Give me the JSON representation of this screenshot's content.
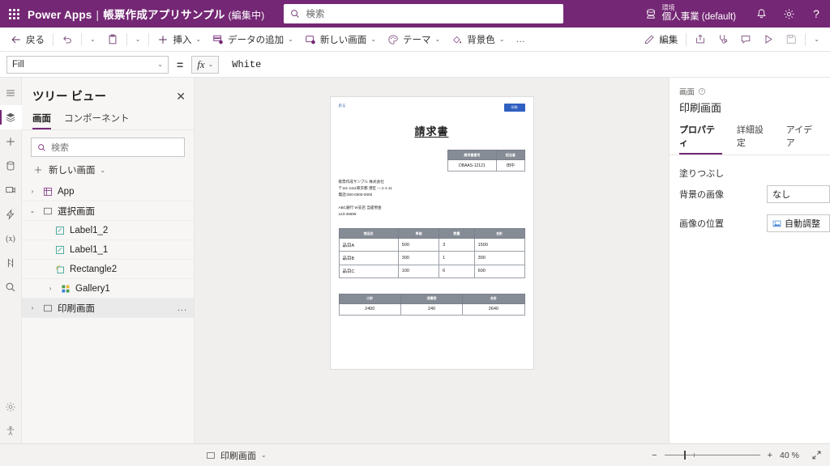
{
  "header": {
    "waffle_icon": "app-launcher-icon",
    "brand": "Power Apps",
    "separator": "|",
    "app_name": "帳票作成アプリサンプル",
    "editing_state": "(編集中)",
    "search_placeholder": "検索",
    "search_icon": "search-icon",
    "environment_label": "環境",
    "environment_value": "個人事業 (default)",
    "environment_icon": "environment-icon",
    "notification_icon": "bell-icon",
    "settings_icon": "gear-icon",
    "help_icon": "question-icon",
    "accent": "#742774"
  },
  "commandbar": {
    "back": "戻る",
    "back_icon": "arrow-left-icon",
    "undo_icon": "undo-icon",
    "paste_icon": "paste-icon",
    "insert": "挿入",
    "insert_icon": "plus-icon",
    "add_data": "データの追加",
    "add_data_icon": "database-add-icon",
    "new_screen": "新しい画面",
    "new_screen_icon": "new-screen-icon",
    "theme": "テーマ",
    "theme_icon": "palette-icon",
    "background_color": "背景色",
    "background_color_icon": "fill-color-icon",
    "overflow": "…",
    "edit": "編集",
    "edit_icon": "pencil-icon",
    "share_icon": "share-icon",
    "checker_icon": "app-checker-icon",
    "comment_icon": "comment-icon",
    "preview_icon": "play-icon",
    "save_icon": "save-icon",
    "more_chevron_icon": "chevron-down-icon"
  },
  "formulabar": {
    "property": "Fill",
    "equals": "=",
    "fx": "fx",
    "formula": "White"
  },
  "rail": {
    "items": [
      {
        "name": "hamburger-icon"
      },
      {
        "name": "tree-view-icon"
      },
      {
        "name": "insert-icon"
      },
      {
        "name": "data-icon"
      },
      {
        "name": "media-icon"
      },
      {
        "name": "power-automate-icon"
      },
      {
        "name": "variables-icon"
      },
      {
        "name": "advanced-tools-icon"
      },
      {
        "name": "search-icon"
      }
    ],
    "bottom": [
      {
        "name": "settings-icon"
      },
      {
        "name": "accessibility-icon"
      }
    ]
  },
  "treeview": {
    "title": "ツリー ビュー",
    "close_icon": "close-icon",
    "tabs": [
      {
        "label": "画面",
        "active": true
      },
      {
        "label": "コンポーネント",
        "active": false
      }
    ],
    "search_placeholder": "検索",
    "new_screen": "新しい画面",
    "nodes": [
      {
        "label": "App",
        "level": 0,
        "twist": "›",
        "icon": "app-icon",
        "selected": false
      },
      {
        "label": "選択画面",
        "level": 0,
        "twist": "⌄",
        "icon": "screen-icon",
        "selected": false
      },
      {
        "label": "Label1_2",
        "level": 2,
        "twist": "",
        "icon": "label-icon",
        "selected": false
      },
      {
        "label": "Label1_1",
        "level": 2,
        "twist": "",
        "icon": "label-icon",
        "selected": false
      },
      {
        "label": "Rectangle2",
        "level": 2,
        "twist": "",
        "icon": "rectangle-icon",
        "selected": false
      },
      {
        "label": "Gallery1",
        "level": 1,
        "twist": "›",
        "icon": "gallery-icon",
        "selected": false
      },
      {
        "label": "印刷画面",
        "level": 0,
        "twist": "›",
        "icon": "screen-icon",
        "selected": true,
        "overflow": "..."
      }
    ]
  },
  "canvas": {
    "back_label": "戻る",
    "print_button": "印刷",
    "invoice_title": "請求書",
    "meta_table": {
      "headers": [
        "請求書番号",
        "担当者"
      ],
      "values": [
        "DBAAS-12121",
        "田中"
      ]
    },
    "company_lines": [
      "帳票作成サンプル 株式会社",
      "〒111-1111東京都 港区 ○○1-1-11",
      "電話:000-0000-0000"
    ],
    "bank_lines": [
      "ABC銀行 W支店 当座預金",
      "123-45689"
    ],
    "items_table": {
      "headers": [
        "商品名",
        "単価",
        "数量",
        "合計"
      ],
      "rows": [
        [
          "品目A",
          "500",
          "3",
          "1500"
        ],
        [
          "品目B",
          "300",
          "1",
          "300"
        ],
        [
          "品目C",
          "100",
          "6",
          "600"
        ]
      ]
    },
    "totals_table": {
      "headers": [
        "小計",
        "消費税",
        "合計"
      ],
      "values": [
        "2400",
        "240",
        "2640"
      ]
    }
  },
  "properties": {
    "kicker": "画面",
    "help_icon": "help-circle-icon",
    "title": "印刷画面",
    "tabs": [
      {
        "label": "プロパティ",
        "active": true
      },
      {
        "label": "詳細設定",
        "active": false
      },
      {
        "label": "アイデア",
        "active": false
      }
    ],
    "fill_label": "塗りつぶし",
    "rows": [
      {
        "label": "背景の画像",
        "value": "なし",
        "icon": ""
      },
      {
        "label": "画像の位置",
        "value": "自動調整",
        "icon": "image-icon"
      }
    ]
  },
  "statusbar": {
    "screen_icon": "screen-icon",
    "screen_name": "印刷画面",
    "chevron_icon": "chevron-down-icon",
    "zoom_out": "−",
    "zoom_in": "+",
    "zoom_level": "40 %",
    "fit_icon": "fit-screen-icon"
  }
}
